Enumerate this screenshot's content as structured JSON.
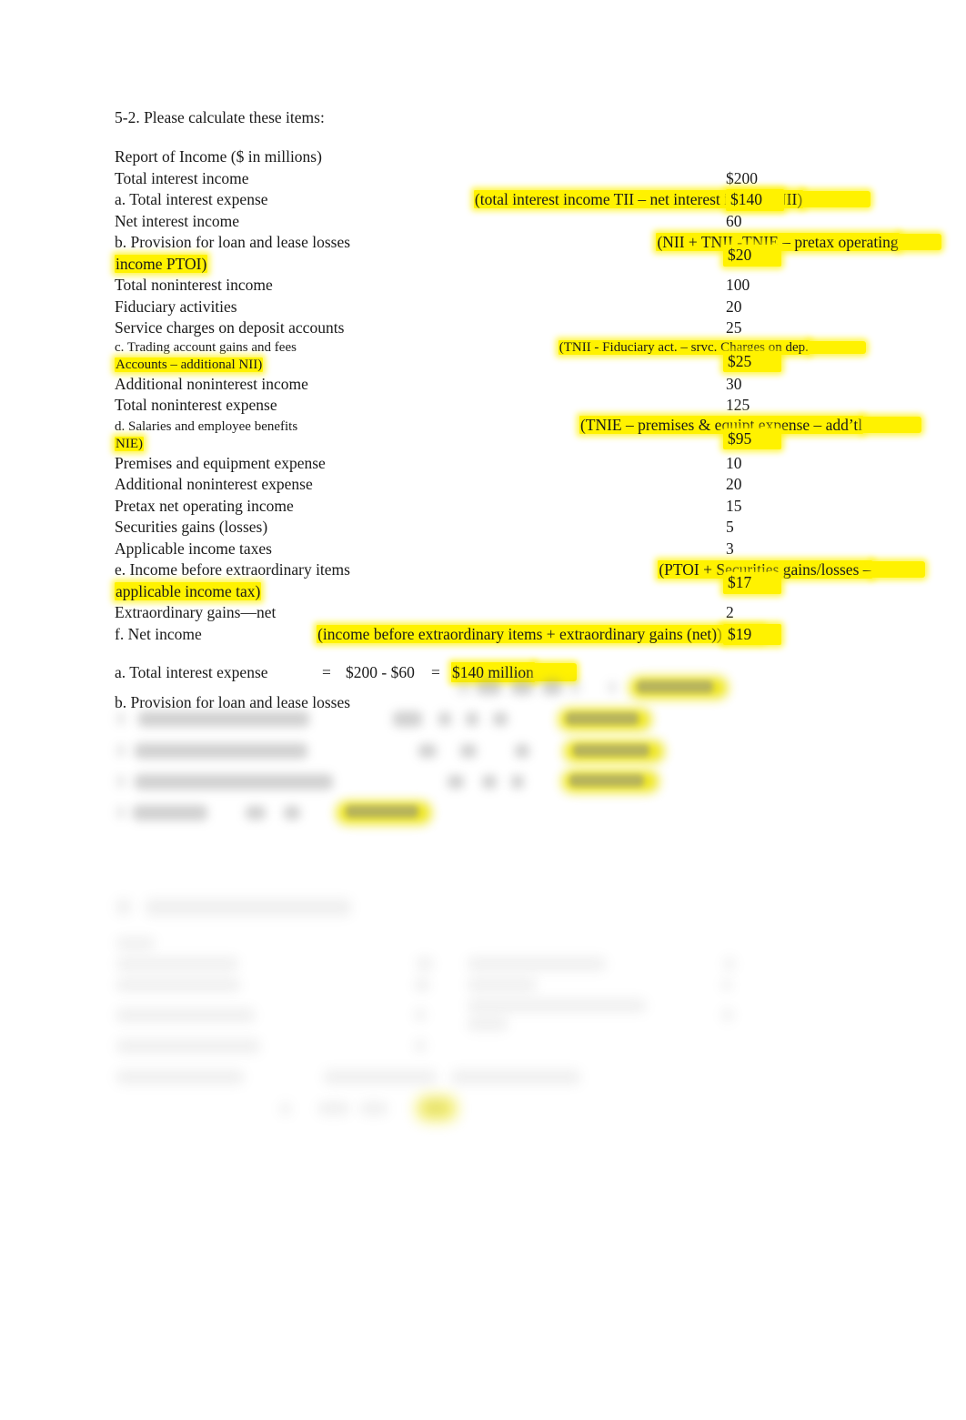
{
  "document": {
    "question_title": "5-2. Please calculate these items:",
    "section_heading": "Report of Income ($ in millions)"
  },
  "statement": {
    "rows": [
      {
        "label": "Total interest income",
        "note": "",
        "value": "$200",
        "value_highlighted": false,
        "note_highlighted": false
      },
      {
        "label": "a. Total interest expense",
        "note": "(total interest income TII – net interest income NII)",
        "value": "$140",
        "value_highlighted": true,
        "note_highlighted": true
      },
      {
        "label": "Net interest income",
        "note": "",
        "value": "60",
        "value_highlighted": false,
        "note_highlighted": false
      },
      {
        "label": "b. Provision for loan and lease losses",
        "label_line2": "income PTOI)",
        "note": "(NII + TNII -TNIE – pretax operating",
        "value": "$20",
        "value_highlighted": true,
        "note_highlighted": true
      },
      {
        "label": "Total noninterest income",
        "note": "",
        "value": "100",
        "value_highlighted": false,
        "note_highlighted": false
      },
      {
        "label": "Fiduciary activities",
        "note": "",
        "value": "20",
        "value_highlighted": false,
        "note_highlighted": false
      },
      {
        "label": "Service charges on deposit accounts",
        "note": "",
        "value": "25",
        "value_highlighted": false,
        "note_highlighted": false
      },
      {
        "label": "c. Trading account gains and fees",
        "label_line2": "Accounts – additional NII)",
        "note": "(TNII - Fiduciary act. – srvc. Charges on dep.",
        "value": "$25",
        "value_highlighted": true,
        "note_highlighted": true
      },
      {
        "label": "Additional noninterest income",
        "note": "",
        "value": "30",
        "value_highlighted": false,
        "note_highlighted": false
      },
      {
        "label": "Total noninterest expense",
        "note": "",
        "value": "125",
        "value_highlighted": false,
        "note_highlighted": false
      },
      {
        "label": "d. Salaries and employee benefits",
        "label_line2": "NIE)",
        "note": "(TNIE – premises & equipt expense – add’tl",
        "value": "$95",
        "value_highlighted": true,
        "note_highlighted": true
      },
      {
        "label": "Premises and equipment expense",
        "note": "",
        "value": "10",
        "value_highlighted": false,
        "note_highlighted": false
      },
      {
        "label": "Additional noninterest expense",
        "note": "",
        "value": "20",
        "value_highlighted": false,
        "note_highlighted": false
      },
      {
        "label": "Pretax net operating income",
        "note": "",
        "value": "15",
        "value_highlighted": false,
        "note_highlighted": false
      },
      {
        "label": "Securities gains (losses)",
        "note": "",
        "value": "5",
        "value_highlighted": false,
        "note_highlighted": false
      },
      {
        "label": "Applicable income taxes",
        "note": "",
        "value": "3",
        "value_highlighted": false,
        "note_highlighted": false
      },
      {
        "label": "e. Income before extraordinary items",
        "label_line2": "applicable income tax)",
        "note": "(PTOI + Securities gains/losses –",
        "value": "$17",
        "value_highlighted": true,
        "note_highlighted": true
      },
      {
        "label": "Extraordinary gains—net",
        "note": "",
        "value": "2",
        "value_highlighted": false,
        "note_highlighted": false
      },
      {
        "label": "f. Net income",
        "note": "(income before extraordinary items + extraordinary gains (net))",
        "value": "$19",
        "value_highlighted": true,
        "note_highlighted": true
      }
    ]
  },
  "worked_answers": {
    "rows": [
      {
        "label": "a. Total interest expense",
        "eq1": "=",
        "expr1": "$200 - $60",
        "eq2": "=",
        "expr2": "$140 million",
        "result_highlighted": true
      },
      {
        "label": "b. Provision for loan and lease losses",
        "eq1": "",
        "expr1": "",
        "eq2": "",
        "expr2": "",
        "result_highlighted": true,
        "obscured": true
      }
    ]
  },
  "colors": {
    "highlight": "#fff200",
    "text": "#1a1a1a",
    "page_background": "#ffffff"
  }
}
